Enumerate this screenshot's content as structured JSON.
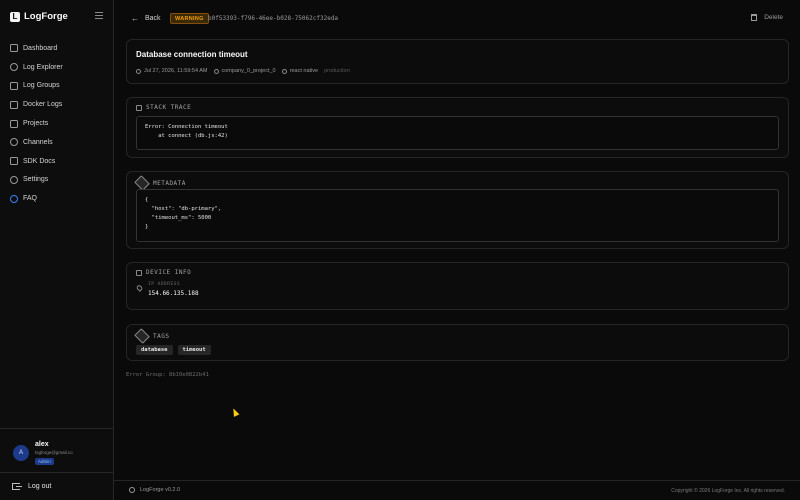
{
  "app": {
    "name": "LogForge",
    "logo_letter": "L"
  },
  "sidebar": {
    "items": [
      {
        "label": "Dashboard",
        "icon": "grid-icon"
      },
      {
        "label": "Log Explorer",
        "icon": "search-icon"
      },
      {
        "label": "Log Groups",
        "icon": "layers-icon"
      },
      {
        "label": "Docker Logs",
        "icon": "box-icon"
      },
      {
        "label": "Projects",
        "icon": "folder-icon"
      },
      {
        "label": "Channels",
        "icon": "radio-icon"
      },
      {
        "label": "SDK Docs",
        "icon": "code-icon"
      },
      {
        "label": "Settings",
        "icon": "gear-icon"
      },
      {
        "label": "FAQ",
        "icon": "help-icon"
      }
    ],
    "user": {
      "initial": "A",
      "name": "alex",
      "email": "logforge@gmail.co",
      "role": "Admin"
    },
    "logout_label": "Log out"
  },
  "header": {
    "back_label": "Back",
    "level": "WARNING",
    "log_id": "b0f53393-f796-46ee-b028-75062cf32eda",
    "delete_label": "Delete"
  },
  "log": {
    "message": "Database connection timeout",
    "timestamp": "Jul 27, 2026, 11:59:54 AM",
    "project": "company_0_project_0",
    "platform": "react native",
    "environment": "production"
  },
  "stack_trace": {
    "title": "STACK TRACE",
    "content": "Error: Connection timeout\n    at connect (db.js:42)"
  },
  "metadata": {
    "title": "METADATA",
    "content": "{\n  \"host\": \"db-primary\",\n  \"timeout_ms\": 5000\n}"
  },
  "device_info": {
    "title": "DEVICE INFO",
    "ip_label": "IP ADDRESS",
    "ip_value": "154.66.135.188"
  },
  "tags": {
    "title": "TAGS",
    "items": [
      "database",
      "timeout"
    ]
  },
  "error_group": "Error Group: 8b10e0822b41",
  "footer": {
    "version": "LogForge v0.2.0",
    "copyright": "Copyright © 2026 LogForge Inc. All rights reserved."
  },
  "colors": {
    "warning": "#f59e0b",
    "accent": "#3b82f6",
    "background": "#0a0a0a"
  }
}
